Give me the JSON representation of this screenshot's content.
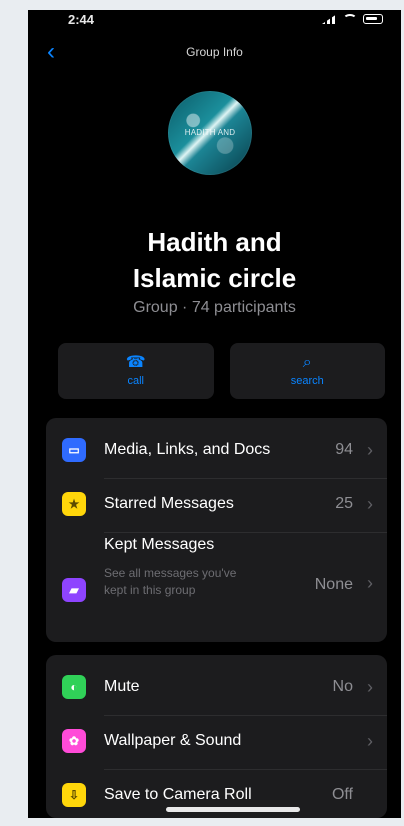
{
  "status": {
    "time": "2:44"
  },
  "nav": {
    "title": "Group Info"
  },
  "group": {
    "avatar_text": "HADITH AND",
    "name": "Hadith and\nIslamic circle",
    "meta": "Group · 74 participants"
  },
  "actions": [
    {
      "label": "call",
      "icon": "phone-icon"
    },
    {
      "label": "search",
      "icon": "search-icon"
    }
  ],
  "settings": {
    "section1": [
      {
        "label": "Media, Links, and Docs",
        "value": "94",
        "color": "#2f6bff",
        "icon": "media-icon"
      },
      {
        "label": "Starred Messages",
        "value": "25",
        "color": "#ffd60a",
        "icon": "star-icon"
      },
      {
        "label": "Kept Messages",
        "sublabel": "See all messages you've kept in this group",
        "value": "None",
        "color": "#8e44ff",
        "icon": "bookmark-icon"
      }
    ],
    "section2": [
      {
        "label": "Mute",
        "value": "No",
        "color": "#30d158",
        "icon": "mute-icon"
      },
      {
        "label": "Wallpaper & Sound",
        "value": "",
        "color": "#ff4bd8",
        "icon": "wallpaper-icon"
      },
      {
        "label": "Save to Camera Roll",
        "value": "Off",
        "color": "#ffd60a",
        "icon": "download-icon"
      }
    ]
  }
}
